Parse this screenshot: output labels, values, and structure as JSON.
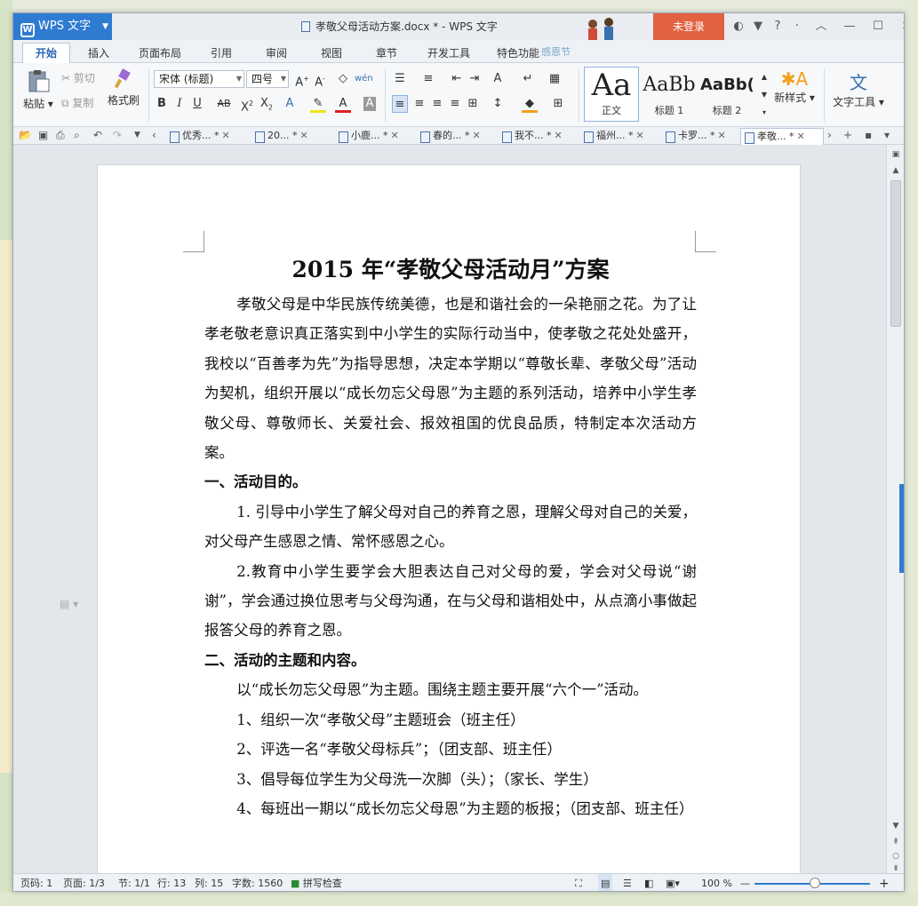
{
  "title_bar": {
    "app_button": "WPS 文字",
    "document_title": "孝敬父母活动方案.docx * - WPS 文字",
    "login_button": "未登录",
    "icons": [
      "skin-icon",
      "shirt-icon",
      "help-icon",
      "ribbon-collapse-icon",
      "minimize-icon",
      "maximize-icon",
      "close-icon"
    ]
  },
  "menu_tabs": [
    "开始",
    "插入",
    "页面布局",
    "引用",
    "审阅",
    "视图",
    "章节",
    "开发工具",
    "特色功能"
  ],
  "festival_label": "感恩节",
  "ribbon": {
    "paste": "粘贴",
    "cut": "剪切",
    "copy": "复制",
    "format_painter": "格式刷",
    "font_name": "宋体 (标题)",
    "font_size": "四号",
    "styles": [
      {
        "sample": "Aa",
        "label": "正文"
      },
      {
        "sample": "AaBb",
        "label": "标题 1"
      },
      {
        "sample": "AaBb(",
        "label": "标题 2"
      }
    ],
    "new_style": "新样式",
    "text_tools": "文字工具"
  },
  "doc_tabs": [
    {
      "label": "优秀... *",
      "active": false
    },
    {
      "label": "20... *",
      "active": false
    },
    {
      "label": "小鹿... *",
      "active": false
    },
    {
      "label": "春的... *",
      "active": false
    },
    {
      "label": "我不... *",
      "active": false
    },
    {
      "label": "福州... *",
      "active": false
    },
    {
      "label": "卡罗... *",
      "active": false
    },
    {
      "label": "孝敬... *",
      "active": true
    }
  ],
  "document": {
    "title": "2015 年“孝敬父母活动月”方案",
    "paragraphs": [
      {
        "style": "ind",
        "text": "孝敬父母是中华民族传统美德，也是和谐社会的一朵艳丽之花。为了让孝老敬老意识真正落实到中小学生的实际行动当中，使孝敬之花处处盛开，我校以“百善孝为先”为指导思想，决定本学期以“尊敬长辈、孝敬父母”活动为契机，组织开展以“成长勿忘父母恩”为主题的系列活动，培养中小学生孝敬父母、尊敬师长、关爱社会、报效祖国的优良品质，特制定本次活动方案。"
      },
      {
        "style": "h",
        "text": "一、活动目的。"
      },
      {
        "style": "ind",
        "text": "1. 引导中小学生了解父母对自己的养育之恩，理解父母对自己的关爱，对父母产生感恩之情、常怀感恩之心。"
      },
      {
        "style": "ind",
        "text": "2.教育中小学生要学会大胆表达自己对父母的爱，学会对父母说“谢谢”，学会通过换位思考与父母沟通，在与父母和谐相处中，从点滴小事做起报答父母的养育之恩。"
      },
      {
        "style": "h",
        "text": "二、活动的主题和内容。"
      },
      {
        "style": "ind",
        "text": "以“成长勿忘父母恩”为主题。围绕主题主要开展“六个一”活动。"
      },
      {
        "style": "ind",
        "text": "1、组织一次“孝敬父母”主题班会（班主任）"
      },
      {
        "style": "ind",
        "text": "2、评选一名“孝敬父母标兵”；（团支部、班主任）"
      },
      {
        "style": "ind",
        "text": "3、倡导每位学生为父母洗一次脚（头）；（家长、学生）"
      },
      {
        "style": "ind",
        "text": "4、每班出一期以“成长勿忘父母恩”为主题的板报；（团支部、班主任）"
      }
    ]
  },
  "status_bar": {
    "line_no": "页码: 1",
    "page": "页面: 1/3",
    "section": "节: 1/1",
    "row": "行: 13",
    "col": "列: 15",
    "word_count": "字数: 1560",
    "spell_check": "拼写检查",
    "zoom": "100 %"
  }
}
